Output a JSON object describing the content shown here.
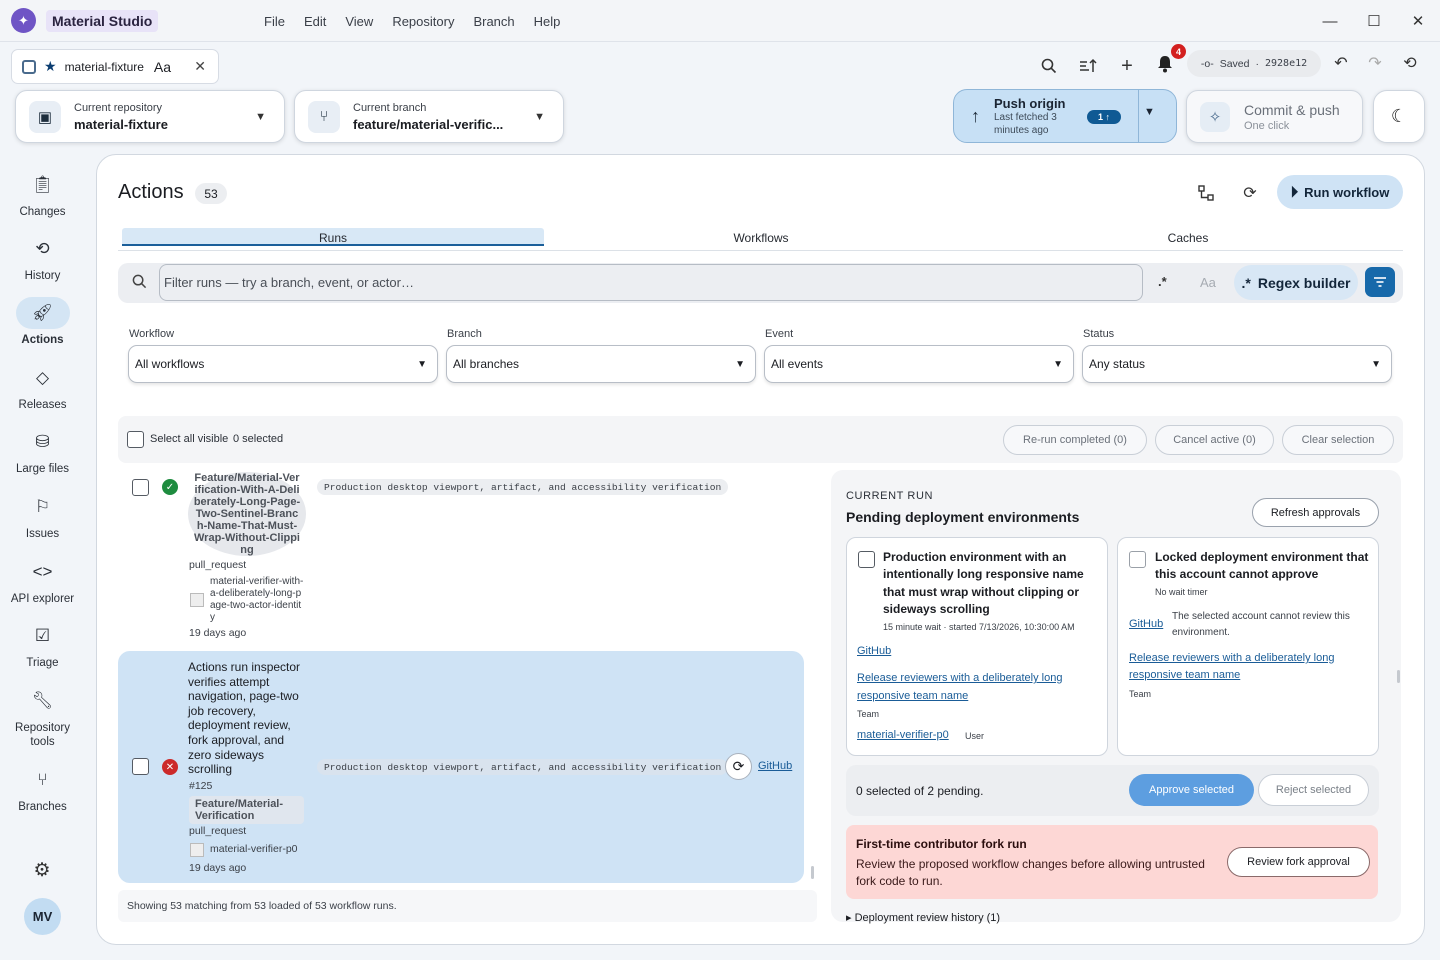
{
  "app": {
    "name": "Material Studio",
    "logo_icon": "sparkle-icon"
  },
  "menu": [
    "File",
    "Edit",
    "View",
    "Repository",
    "Branch",
    "Help"
  ],
  "tab": {
    "name": "material-fixture",
    "font_toggle": "Aa"
  },
  "toolbar": {
    "notifications_count": "4",
    "saved_label": "Saved",
    "commit_hash": "2928e12"
  },
  "repo": {
    "label": "Current repository",
    "value": "material-fixture"
  },
  "branch": {
    "label": "Current branch",
    "value": "feature/material-verific..."
  },
  "push": {
    "title": "Push origin",
    "subtitle": "Last fetched 3 minutes ago",
    "ahead": "1 ↑"
  },
  "commit": {
    "title": "Commit & push",
    "subtitle": "One click"
  },
  "nav": [
    {
      "label": "Changes",
      "icon": "clipboard-icon"
    },
    {
      "label": "History",
      "icon": "history-icon"
    },
    {
      "label": "Actions",
      "icon": "rocket-icon"
    },
    {
      "label": "Releases",
      "icon": "tag-icon"
    },
    {
      "label": "Large files",
      "icon": "database-icon"
    },
    {
      "label": "Issues",
      "icon": "flag-icon"
    },
    {
      "label": "API explorer",
      "icon": "code-icon"
    },
    {
      "label": "Triage",
      "icon": "checklist-icon"
    },
    {
      "label": "Repository tools",
      "icon": "wrench-icon"
    },
    {
      "label": "Branches",
      "icon": "branch-icon"
    }
  ],
  "user": {
    "initials": "MV"
  },
  "actions": {
    "title": "Actions",
    "count": "53",
    "run_workflow": "Run workflow",
    "tabs": [
      "Runs",
      "Workflows",
      "Caches"
    ],
    "filter_placeholder": "Filter runs — try a branch, event, or actor…",
    "regex_toggle": ".*",
    "case_toggle": "Aa",
    "regex_builder": "Regex builder",
    "filters": [
      {
        "label": "Workflow",
        "value": "All workflows"
      },
      {
        "label": "Branch",
        "value": "All branches"
      },
      {
        "label": "Event",
        "value": "All events"
      },
      {
        "label": "Status",
        "value": "Any status"
      }
    ],
    "bulk": {
      "select_all": "Select all visible",
      "selected": "0 selected",
      "rerun": "Re-run completed (0)",
      "cancel": "Cancel active (0)",
      "clear": "Clear selection"
    },
    "runs": [
      {
        "branch": "Feature/Material-Verification-With-A-Deliberately-Long-Page-Two-Sentinel-Branch-Name-That-Must-Wrap-Without-Clipping",
        "event": "pull_request",
        "actor": "material-verifier-with-a-deliberately-long-page-two-actor-identity",
        "age": "19 days ago",
        "workflow": "Production desktop viewport, artifact, and accessibility verification",
        "status": "success"
      },
      {
        "title": "Actions run inspector verifies attempt navigation, page-two job recovery, deployment review, fork approval, and zero sideways scrolling",
        "number": "#125",
        "branch": "Feature/Material-Verification",
        "event": "pull_request",
        "actor": "material-verifier-p0",
        "age": "19 days ago",
        "workflow": "Production desktop viewport, artifact, and accessibility verification",
        "link": "GitHub",
        "status": "failure"
      }
    ],
    "footer": "Showing 53 matching from 53 loaded of 53 workflow runs."
  },
  "current_run": {
    "eyebrow": "CURRENT RUN",
    "title": "Pending deployment environments",
    "refresh": "Refresh approvals",
    "envs": [
      {
        "name": "Production environment with an intentionally long responsive name that must wrap without clipping or sideways scrolling",
        "meta": "15 minute wait · started 7/13/2026, 10:30:00 AM",
        "link": "GitHub",
        "reviewers": "Release reviewers with a deliberately long responsive team name",
        "reviewer_type": "Team",
        "user": "material-verifier-p0",
        "user_type": "User"
      },
      {
        "name": "Locked deployment environment that this account cannot approve",
        "meta": "No wait timer",
        "link": "GitHub",
        "note": "The selected account cannot review this environment.",
        "reviewers": "Release reviewers with a deliberately long responsive team name",
        "reviewer_type": "Team"
      }
    ],
    "summary": "0 selected of 2 pending.",
    "approve": "Approve selected",
    "reject": "Reject selected",
    "fork": {
      "title": "First-time contributor fork run",
      "body": "Review the proposed workflow changes before allowing untrusted fork code to run.",
      "button": "Review fork approval"
    },
    "history": "▸ Deployment review history (1)"
  }
}
